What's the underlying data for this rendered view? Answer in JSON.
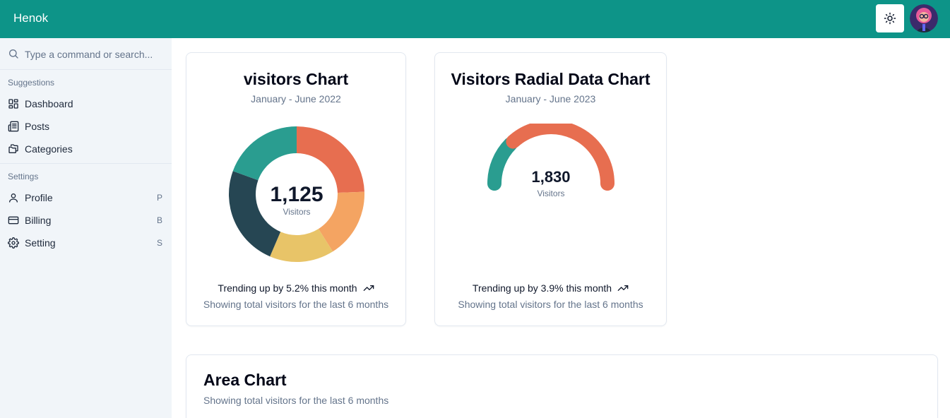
{
  "header": {
    "brand": "Henok",
    "theme_icon": "sun-icon",
    "avatar_icon": "user-avatar",
    "color": "#0d9488"
  },
  "sidebar": {
    "search": {
      "placeholder": "Type a command or search...",
      "icon": "search-icon"
    },
    "groups": [
      {
        "label": "Suggestions",
        "items": [
          {
            "label": "Dashboard",
            "icon": "dashboard-icon"
          },
          {
            "label": "Posts",
            "icon": "posts-icon"
          },
          {
            "label": "Categories",
            "icon": "categories-icon"
          }
        ]
      },
      {
        "label": "Settings",
        "items": [
          {
            "label": "Profile",
            "icon": "user-icon",
            "shortcut": "P"
          },
          {
            "label": "Billing",
            "icon": "credit-card-icon",
            "shortcut": "B"
          },
          {
            "label": "Setting",
            "icon": "gear-icon",
            "shortcut": "S"
          }
        ]
      }
    ]
  },
  "cards": {
    "donut": {
      "title": "visitors Chart",
      "subtitle": "January - June 2022",
      "trend": "Trending up by 5.2% this month",
      "footnote": "Showing total visitors for the last 6 months"
    },
    "radial": {
      "title": "Visitors Radial Data Chart",
      "subtitle": "January - June 2023",
      "trend": "Trending up by 3.9% this month",
      "footnote": "Showing total visitors for the last 6 months"
    },
    "area": {
      "title": "Area Chart",
      "subtitle": "Showing total visitors for the last 6 months"
    }
  },
  "chart_data": [
    {
      "type": "pie",
      "center_value": "1,125",
      "center_label": "Visitors",
      "total": 1125,
      "slices": [
        {
          "value": 275,
          "color": "#e76e50"
        },
        {
          "value": 187,
          "color": "#f4a462"
        },
        {
          "value": 173,
          "color": "#e8c468"
        },
        {
          "value": 271,
          "color": "#264653"
        },
        {
          "value": 219,
          "color": "#2a9d90"
        }
      ]
    },
    {
      "type": "pie",
      "center_value": "1,830",
      "center_label": "Visitors",
      "total": 1830,
      "slices": [
        {
          "value": 470,
          "color": "#2a9d90"
        },
        {
          "value": 1360,
          "color": "#e76e50"
        }
      ]
    }
  ]
}
